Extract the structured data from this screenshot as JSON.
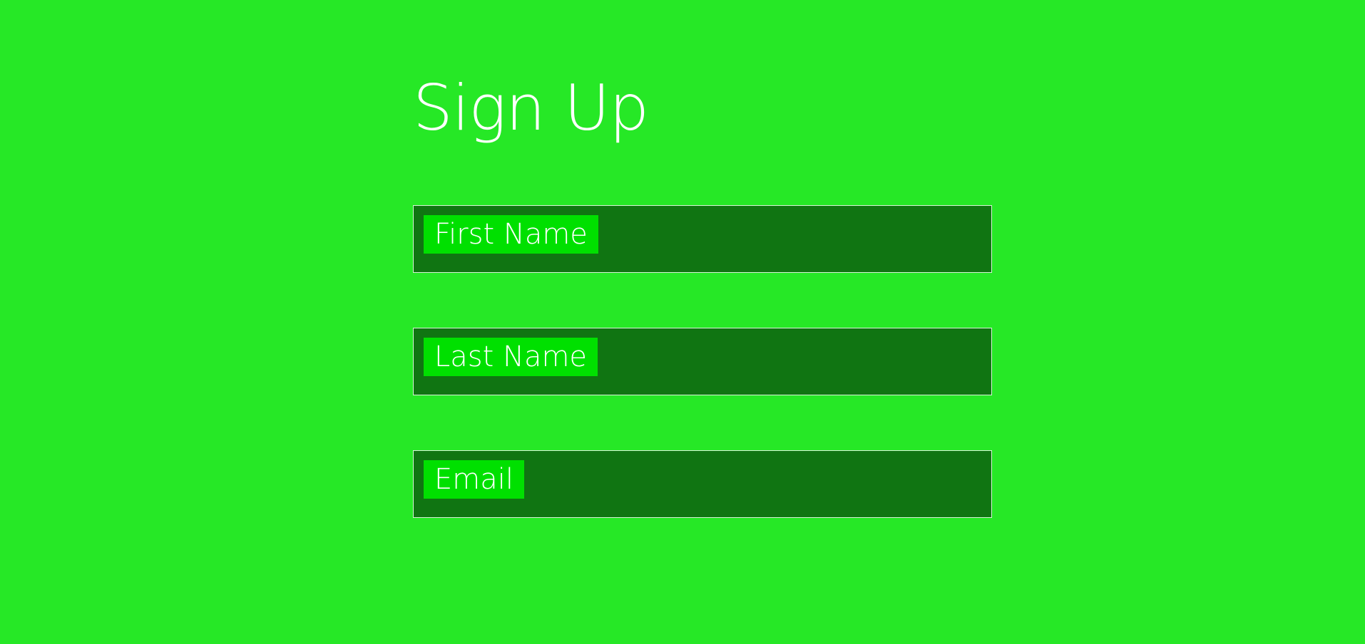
{
  "form": {
    "title": "Sign Up",
    "fields": [
      {
        "label": "First Name",
        "value": ""
      },
      {
        "label": "Last Name",
        "value": ""
      },
      {
        "label": "Email",
        "value": ""
      }
    ]
  },
  "colors": {
    "background": "#26e826",
    "field_background": "#107512",
    "label_background": "#00e000",
    "field_border": "#d7f3d7",
    "text": "#ffffff"
  }
}
